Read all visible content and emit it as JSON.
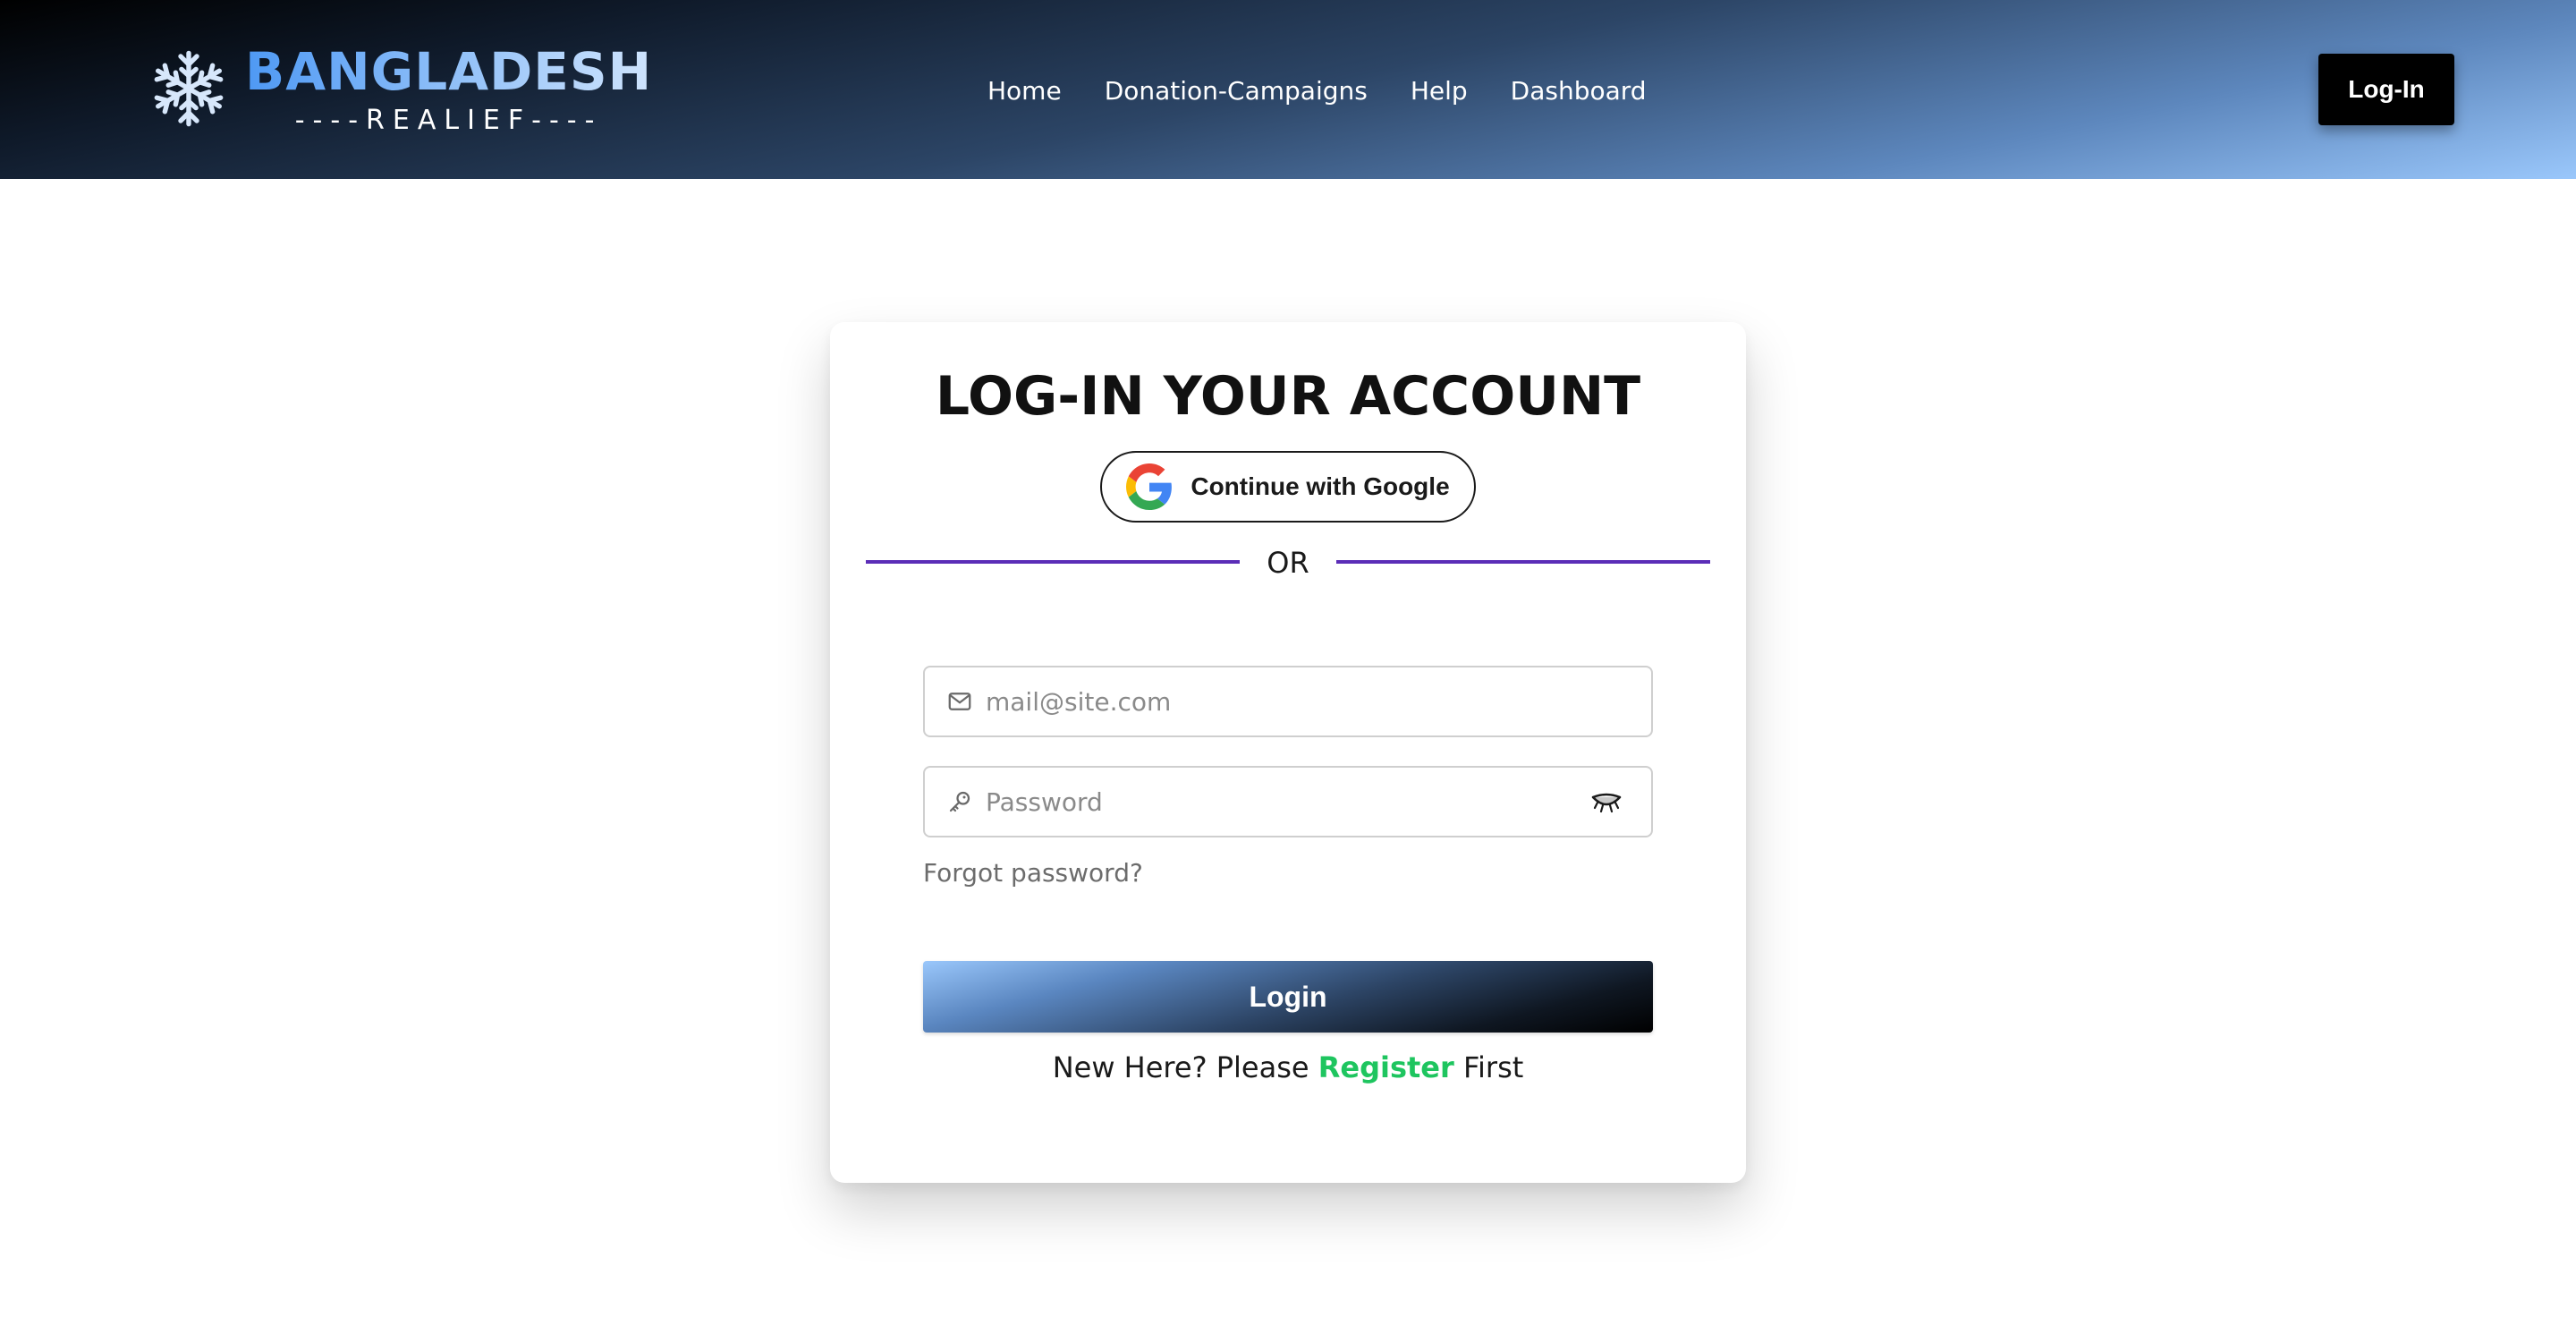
{
  "navbar": {
    "logo": {
      "icon": "snowflake-icon",
      "title": "BANGLADESH",
      "subtitle": "----REALIEF----"
    },
    "links": [
      {
        "label": "Home"
      },
      {
        "label": "Donation-Campaigns"
      },
      {
        "label": "Help"
      },
      {
        "label": "Dashboard"
      }
    ],
    "login_button": "Log-In"
  },
  "login_card": {
    "title": "LOG-IN YOUR ACCOUNT",
    "google_button": {
      "label": "Continue with Google",
      "icon": "google-icon"
    },
    "divider_text": "OR",
    "email": {
      "placeholder": "mail@site.com",
      "value": "",
      "icon": "mail-icon"
    },
    "password": {
      "placeholder": "Password",
      "value": "",
      "icon": "key-icon",
      "toggle_icon": "eye-closed-icon"
    },
    "forgot_password": "Forgot password?",
    "login_button": "Login",
    "register_prefix": "New Here? Please",
    "register_link": "Register",
    "register_suffix": "First"
  },
  "colors": {
    "accent_divider": "#5b2db7",
    "register_link": "#1ec55f",
    "logo_blue": "#4e99f4",
    "nav_button_bg": "#000000"
  }
}
